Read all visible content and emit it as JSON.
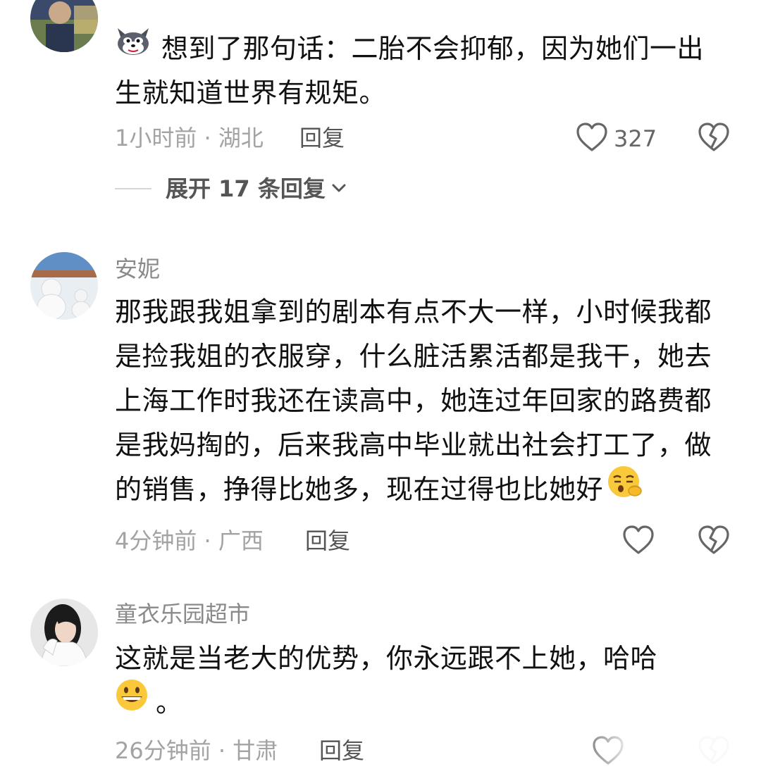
{
  "comments": [
    {
      "text_lines": [
        "想到了那句话：二胎不会抑郁，因为她们一出",
        "生就知道世界有规矩。"
      ],
      "time_location": "1小时前 · 湖北",
      "reply_label": "回复",
      "like_count": "327",
      "leading_icon": "doge-emoji-icon"
    },
    {
      "username": "安妮",
      "text_lines": [
        "那我跟我姐拿到的剧本有点不大一样，小时候我都",
        "是捡我姐的衣服穿，什么脏活累活都是我干，她去",
        "上海工作时我还在读高中，她连过年回家的路费都",
        "是我妈掏的，后来我高中毕业就出社会打工了，做",
        "的销售，挣得比她多，现在过得也比她好"
      ],
      "time_location": "4分钟前 · 广西",
      "reply_label": "回复",
      "trailing_icon": "smug-face-emoji-icon"
    },
    {
      "username": "童衣乐园超市",
      "text_lines": [
        "这就是当老大的优势，你永远跟不上她，哈哈",
        "。"
      ],
      "time_location": "26分钟前 · 甘肃",
      "reply_label": "回复",
      "leading_icon": "grinning-face-emoji-icon"
    }
  ],
  "expand_replies": {
    "label": "展开 17 条回复"
  },
  "icons": {
    "like": "heart-outline-icon",
    "dislike": "broken-heart-icon",
    "expand": "chevron-down-icon"
  }
}
